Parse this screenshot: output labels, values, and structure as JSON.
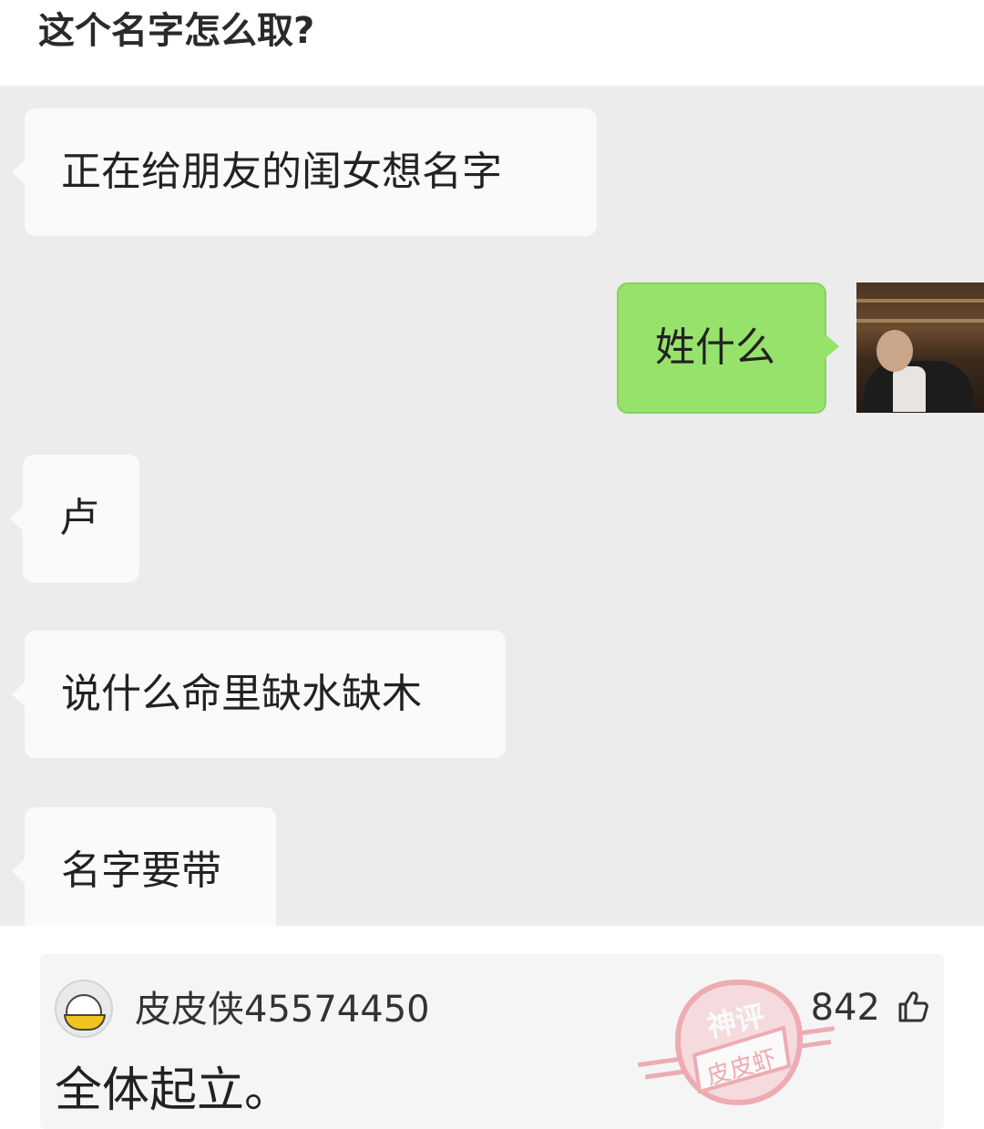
{
  "post": {
    "title": "这个名字怎么取?"
  },
  "chat": {
    "messages": [
      {
        "side": "left",
        "text": "正在给朋友的闺女想名字"
      },
      {
        "side": "right",
        "text": "姓什么"
      },
      {
        "side": "left",
        "text": "卢"
      },
      {
        "side": "left",
        "text": "说什么命里缺水缺木"
      },
      {
        "side": "left",
        "text": "名字要带"
      }
    ],
    "avatar": "avatar-photo"
  },
  "comment": {
    "username": "皮皮侠45574450",
    "likes": "842",
    "text": "全体起立。",
    "like_icon": "thumbs-up-icon"
  },
  "watermark": {
    "line1": "神评",
    "line2": "皮皮虾",
    "color": "#e8707d"
  },
  "colors": {
    "chat_bg": "#ececec",
    "sent_bubble": "#97e26b",
    "received_bubble": "#fafafa"
  }
}
